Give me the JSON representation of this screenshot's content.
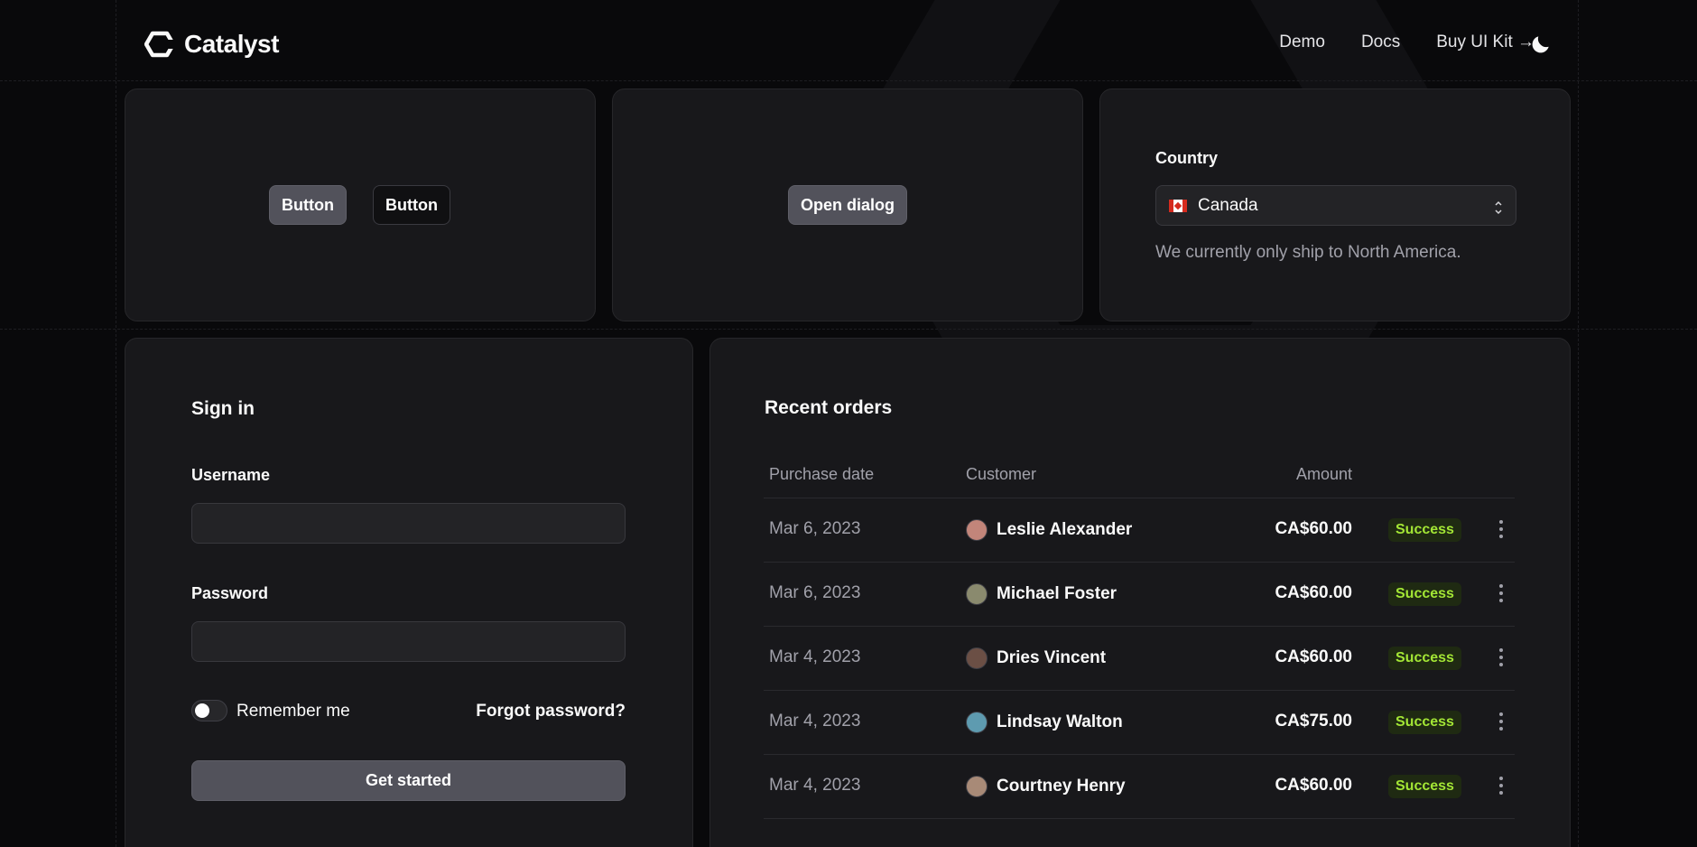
{
  "header": {
    "logo_text": "Catalyst",
    "nav": [
      "Demo",
      "Docs",
      "Buy UI Kit →"
    ]
  },
  "buttons_card": {
    "solid_label": "Button",
    "outline_label": "Button"
  },
  "dialog_card": {
    "open_dialog_label": "Open dialog"
  },
  "country_card": {
    "label": "Country",
    "selected": "Canada",
    "help": "We currently only ship to North America."
  },
  "signin": {
    "title": "Sign in",
    "username_label": "Username",
    "username_value": "",
    "password_label": "Password",
    "password_value": "",
    "remember_label": "Remember me",
    "forgot_label": "Forgot password?",
    "submit_label": "Get started"
  },
  "orders": {
    "title": "Recent orders",
    "columns": [
      "Purchase date",
      "Customer",
      "Amount"
    ],
    "rows": [
      {
        "date": "Mar 6, 2023",
        "customer": "Leslie Alexander",
        "amount": "CA$60.00",
        "status": "Success",
        "avatar_color": "#c2857a"
      },
      {
        "date": "Mar 6, 2023",
        "customer": "Michael Foster",
        "amount": "CA$60.00",
        "status": "Success",
        "avatar_color": "#8a8a6e"
      },
      {
        "date": "Mar 4, 2023",
        "customer": "Dries Vincent",
        "amount": "CA$60.00",
        "status": "Success",
        "avatar_color": "#6b4f45"
      },
      {
        "date": "Mar 4, 2023",
        "customer": "Lindsay Walton",
        "amount": "CA$75.00",
        "status": "Success",
        "avatar_color": "#5e9bb0"
      },
      {
        "date": "Mar 4, 2023",
        "customer": "Courtney Henry",
        "amount": "CA$60.00",
        "status": "Success",
        "avatar_color": "#a88a77"
      }
    ]
  },
  "colors": {
    "accent_success": "#a3e635",
    "card_bg": "#18181b",
    "page_bg": "#09090b"
  }
}
